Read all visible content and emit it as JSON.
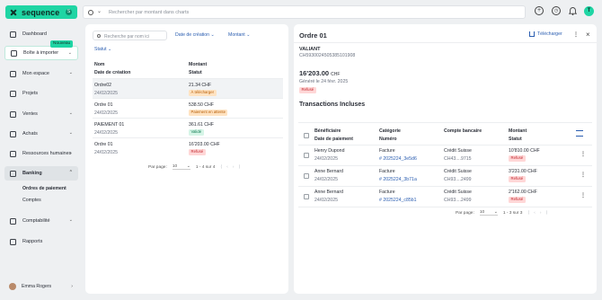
{
  "brand": {
    "name": "sequence",
    "workspace_initial": "S"
  },
  "search": {
    "placeholder": "Rechercher par montant dans charts"
  },
  "top_user_initial": "T",
  "sidebar": {
    "items": [
      {
        "label": "Dashboard"
      },
      {
        "label": "Boîte à importer",
        "badge": "Nouveau"
      },
      {
        "label": "Mon espace"
      },
      {
        "label": "Projets"
      },
      {
        "label": "Ventes"
      },
      {
        "label": "Achats"
      },
      {
        "label": "Ressources humaines"
      },
      {
        "label": "Banking"
      },
      {
        "label": "Comptabilité"
      },
      {
        "label": "Rapports"
      }
    ],
    "banking_sub": [
      "Ordres de paiement",
      "Comptes"
    ],
    "user_name": "Emma Rogers"
  },
  "list": {
    "search_placeholder": "Recherche par nom ici",
    "filters": {
      "date": "Date de création",
      "amount": "Montant",
      "status": "Statut"
    },
    "headers": {
      "name": "Nom",
      "date": "Date de création",
      "amount": "Montant",
      "status": "Statut"
    },
    "rows": [
      {
        "name": "Ordre02",
        "date": "24/02/2025",
        "amount": "21.34 CHF",
        "status": "À télécharger",
        "status_kind": "orange"
      },
      {
        "name": "Ordre 01",
        "date": "24/02/2025",
        "amount": "538.50 CHF",
        "status": "Paiement en attente",
        "status_kind": "orange"
      },
      {
        "name": "PAIEMENT 01",
        "date": "24/02/2025",
        "amount": "361.61 CHF",
        "status": "Validé",
        "status_kind": "green"
      },
      {
        "name": "Ordre 01",
        "date": "24/02/2025",
        "amount": "16'203.00 CHF",
        "status": "Refusé",
        "status_kind": "red"
      }
    ],
    "pager": {
      "per_page_label": "Par page:",
      "per_page": "10",
      "range": "1 - 4 sur 4"
    }
  },
  "detail": {
    "title": "Ordre 01",
    "download_label": "Télécharger",
    "account_name": "VALIANT",
    "iban": "CH5930024505385101908",
    "amount": "16'203.00",
    "currency": "CHF",
    "generated": "Généré le 24 févr. 2025",
    "status": "Refusé",
    "section_title": "Transactions Incluses",
    "headers": {
      "beneficiary": "Bénéficiaire",
      "pay_date": "Date de paiement",
      "category": "Catégorie",
      "number": "Numéro",
      "bank_account": "Compte bancaire",
      "amount": "Montant",
      "status": "Statut"
    },
    "rows": [
      {
        "beneficiary": "Henry Dupond",
        "date": "24/02/2025",
        "category": "Facture",
        "number": "# 2025224_3e5d6",
        "bank": "Crédit Suisse",
        "account": "CH43....9715",
        "amount": "10'810.00 CHF",
        "status": "Refusé"
      },
      {
        "beneficiary": "Anne Bernard",
        "date": "24/02/2025",
        "category": "Facture",
        "number": "# 2025224_3b71a",
        "bank": "Crédit Suisse",
        "account": "CH93....2499",
        "amount": "3'231.00 CHF",
        "status": "Refusé"
      },
      {
        "beneficiary": "Anne Bernard",
        "date": "24/02/2025",
        "category": "Facture",
        "number": "# 2025224_c85b1",
        "bank": "Crédit Suisse",
        "account": "CH93....2499",
        "amount": "2'162.00 CHF",
        "status": "Refusé"
      }
    ],
    "pager": {
      "per_page_label": "Par page:",
      "per_page": "10",
      "range": "1 - 3 sur 3"
    }
  }
}
